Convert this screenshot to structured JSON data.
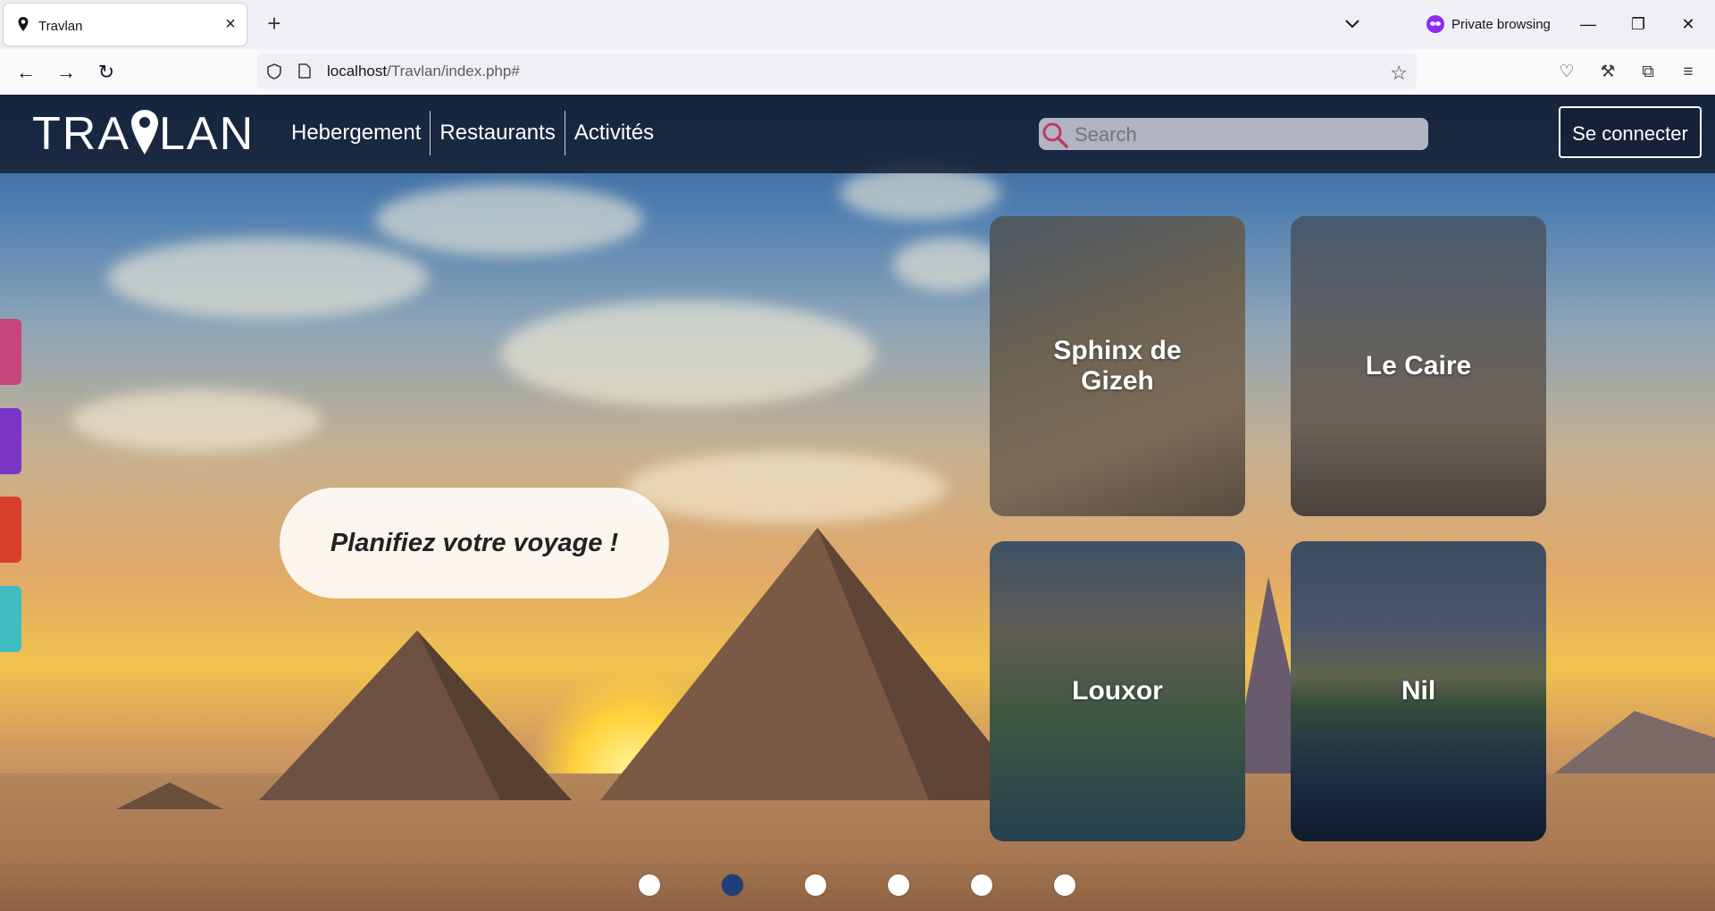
{
  "browser": {
    "tab_title": "Travlan",
    "tab_close": "×",
    "new_tab": "+",
    "private_label": "Private browsing",
    "url_host": "localhost",
    "url_path": "/Travlan/index.php#"
  },
  "site": {
    "logo": "TRAVLAN",
    "logo_left": "TRA",
    "logo_right": "LAN",
    "nav": [
      "Hebergement",
      "Restaurants",
      "Activités"
    ],
    "search_placeholder": "Search",
    "login_label": "Se connecter",
    "cta": "Planifiez votre voyage !",
    "side_tabs": [
      {
        "color": "#c7457a"
      },
      {
        "color": "#7a35c7"
      },
      {
        "color": "#d8402b"
      },
      {
        "color": "#3fbcc0"
      }
    ],
    "cards": [
      {
        "label": "Sphinx de Gizeh"
      },
      {
        "label": "Le Caire"
      },
      {
        "label": "Louxor"
      },
      {
        "label": "Nil"
      }
    ],
    "slider": {
      "count": 6,
      "active_index": 1,
      "active_color": "#1f3f7a"
    }
  }
}
